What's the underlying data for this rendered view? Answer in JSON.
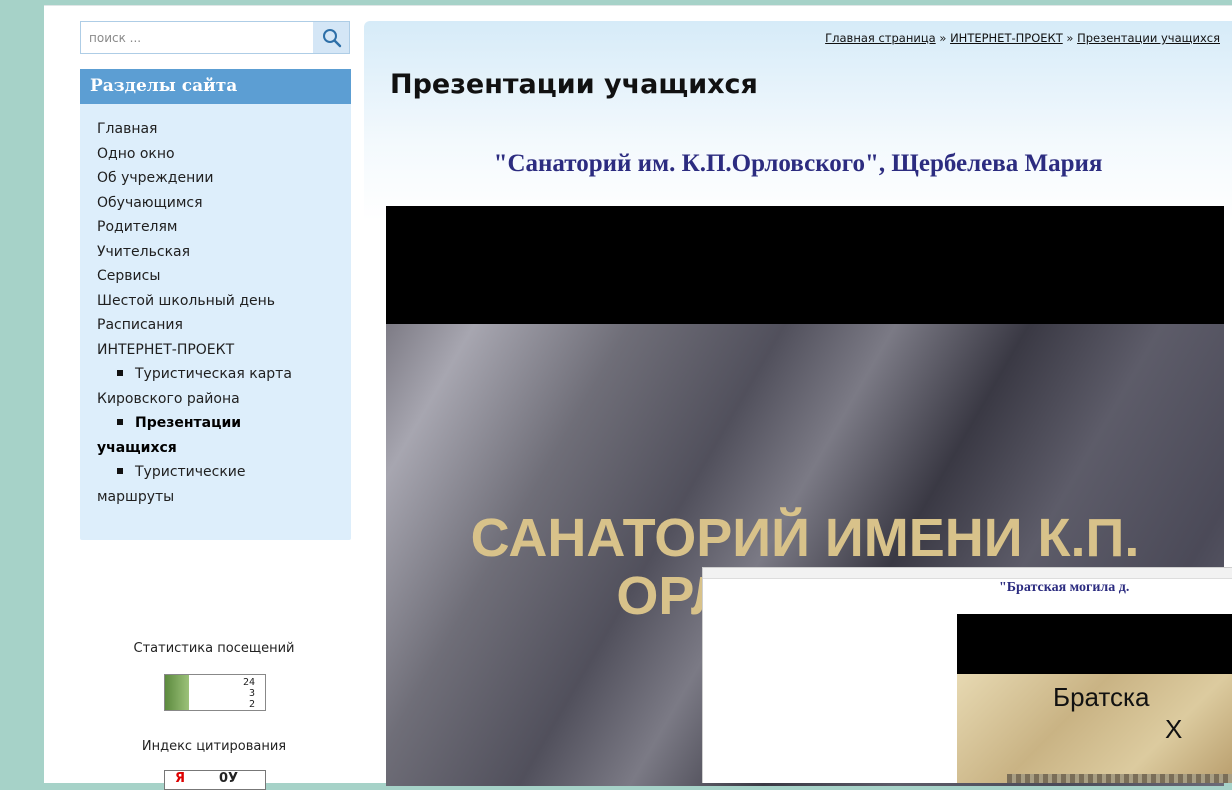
{
  "search": {
    "placeholder": "поиск ..."
  },
  "sidebar": {
    "title": "Разделы сайта",
    "items": [
      {
        "label": "Главная"
      },
      {
        "label": "Одно окно"
      },
      {
        "label": "Об учреждении"
      },
      {
        "label": "Обучающимся"
      },
      {
        "label": "Родителям"
      },
      {
        "label": "Учительская"
      },
      {
        "label": "Сервисы"
      },
      {
        "label": "Шестой школьный день"
      },
      {
        "label": "Расписания"
      },
      {
        "label": "ИНТЕРНЕТ-ПРОЕКТ"
      }
    ],
    "subitems": [
      {
        "label": "Туристическая карта Кировского района"
      },
      {
        "label": "Презентации учащихся",
        "active": true
      },
      {
        "label": "Туристические маршруты"
      }
    ]
  },
  "stats": {
    "label": "Статистика посещений",
    "counter": [
      "24",
      "3",
      "2"
    ]
  },
  "citation": {
    "label": "Индекс цитирования",
    "value": "0У"
  },
  "breadcrumb": {
    "items": [
      "Главная страница",
      "ИНТЕРНЕТ-ПРОЕКТ",
      "Презентации учащихся"
    ],
    "separator": "»"
  },
  "page": {
    "title": "Презентации учащихся",
    "presentation_title": "\"Санаторий им. К.П.Орловского\", Щербелева Мария",
    "slide_text_line1": "САНАТОРИЙ ИМЕНИ К.П.",
    "slide_text_line2": "ОРЛОВСКОГО"
  },
  "overlay": {
    "title": "\"Братская могила д.",
    "slide_text_line1": "Братска",
    "slide_text_line2": "Х"
  },
  "colors": {
    "background": "#a6d2c8",
    "sidebar_header": "#5c9ed3",
    "sidebar_panel": "#ddeefb",
    "presentation_title": "#2c2c80",
    "slide_text": "#d8c28a"
  }
}
